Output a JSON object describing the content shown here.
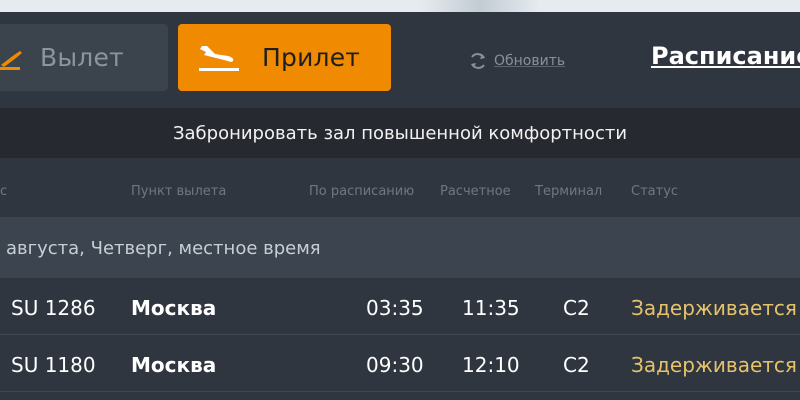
{
  "tabs": {
    "departure_label": "Вылет",
    "arrival_label": "Прилет"
  },
  "refresh_label": "Обновить",
  "schedule_label": "Расписание",
  "banner_text": "Забронировать зал повышенной комфортности",
  "columns": [
    "с",
    "Пункт вылета",
    "По расписанию",
    "Расчетное",
    "Терминал",
    "Статус"
  ],
  "date_row": "августа, Четверг, местное время",
  "flights": [
    {
      "flight": "SU 1286",
      "from": "Москва",
      "scheduled": "03:35",
      "estimated": "11:35",
      "terminal": "C2",
      "status": "Задерживается"
    },
    {
      "flight": "SU 1180",
      "from": "Москва",
      "scheduled": "09:30",
      "estimated": "12:10",
      "terminal": "C2",
      "status": "Задерживается"
    }
  ],
  "colors": {
    "accent": "#f08a00",
    "background": "#2f3640",
    "status_delayed": "#e6c36a"
  },
  "icons": {
    "departure": "plane-takeoff-icon",
    "arrival": "plane-landing-icon",
    "refresh": "refresh-icon"
  }
}
